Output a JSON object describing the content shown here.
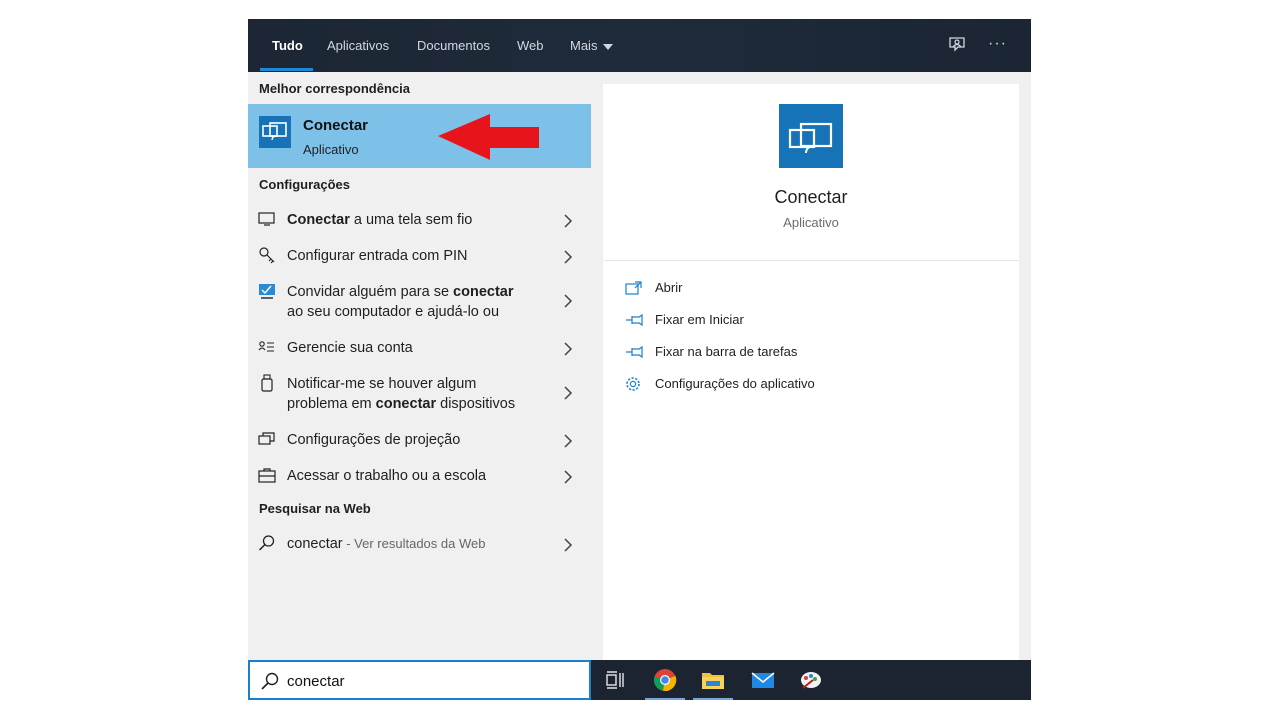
{
  "header": {
    "tabs": [
      {
        "label": "Tudo",
        "active": true
      },
      {
        "label": "Aplicativos"
      },
      {
        "label": "Documentos"
      },
      {
        "label": "Web"
      },
      {
        "label": "Mais"
      }
    ],
    "icons": [
      "feedback-icon",
      "more-options-icon"
    ],
    "more_label": "···"
  },
  "left": {
    "best_match_heading": "Melhor correspondência",
    "best_match": {
      "title": "Conectar",
      "subtitle": "Aplicativo",
      "icon": "connect-app-icon"
    },
    "settings_heading": "Configurações",
    "settings": [
      {
        "icon": "monitor-icon",
        "pre": "",
        "bold": "Conectar",
        "post": " a uma tela sem fio"
      },
      {
        "icon": "key-icon",
        "pre": "Configurar entrada com PIN",
        "bold": "",
        "post": ""
      },
      {
        "icon": "remote-assistance-icon",
        "line1_pre": "Convidar alguém para se ",
        "line1_bold": "conectar",
        "line2": "ao seu computador e ajudá-lo ou"
      },
      {
        "icon": "account-list-icon",
        "pre": "Gerencie sua conta",
        "bold": "",
        "post": ""
      },
      {
        "icon": "usb-device-icon",
        "line1": "Notificar-me se houver algum",
        "line2_pre": "problema em ",
        "line2_bold": "conectar",
        "line2_post": " dispositivos"
      },
      {
        "icon": "projection-icon",
        "pre": "Configurações de projeção",
        "bold": "",
        "post": ""
      },
      {
        "icon": "briefcase-icon",
        "pre": "Acessar o trabalho ou a escola",
        "bold": "",
        "post": ""
      }
    ],
    "web_heading": "Pesquisar na Web",
    "web": {
      "term": "conectar",
      "hint": " - Ver resultados da Web"
    }
  },
  "right": {
    "title": "Conectar",
    "subtitle": "Aplicativo",
    "actions": [
      {
        "label": "Abrir",
        "icon": "open-icon"
      },
      {
        "label": "Fixar em Iniciar",
        "icon": "pin-icon"
      },
      {
        "label": "Fixar na barra de tarefas",
        "icon": "pin-icon"
      },
      {
        "label": "Configurações do aplicativo",
        "icon": "gear-icon"
      }
    ]
  },
  "search": {
    "value": "conectar"
  },
  "taskbar": {
    "items": [
      "task-view-icon",
      "chrome-icon",
      "file-explorer-icon",
      "mail-icon",
      "paint-icon"
    ]
  },
  "colors": {
    "accent": "#1a8ad8",
    "highlight": "#7ec1e8",
    "tile": "#1673b8",
    "arrow": "#e8141c",
    "header_bg": "#1c2634"
  }
}
